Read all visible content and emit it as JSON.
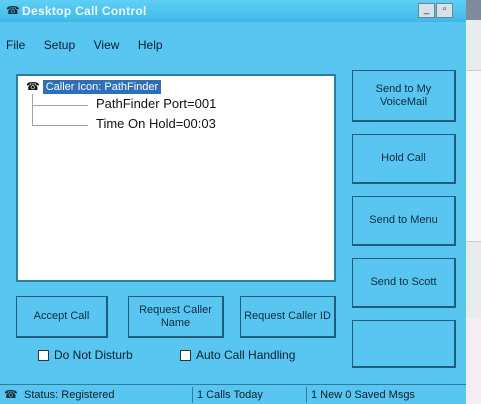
{
  "window": {
    "title": "Desktop Call Control",
    "title_icon": "phone-icon",
    "minimize_glyph": "_",
    "maximize_glyph": "▫"
  },
  "menu": [
    "File",
    "Setup",
    "View",
    "Help"
  ],
  "tree": {
    "root_label": "Caller Icon: PathFinder",
    "root_icon": "phone-icon",
    "children": [
      "PathFinder Port=001",
      "Time On Hold=00:03"
    ]
  },
  "side_buttons": [
    "Send to My VoiceMail",
    "Hold Call",
    "Send to Menu",
    "Send to Scott",
    ""
  ],
  "bottom_buttons": [
    "Accept Call",
    "Request Caller Name",
    "Request Caller ID"
  ],
  "checkboxes": [
    {
      "label": "Do Not Disturb",
      "checked": false
    },
    {
      "label": "Auto Call Handling",
      "checked": false
    }
  ],
  "status": {
    "icon": "phone-icon",
    "state": "Status: Registered",
    "calls": "1 Calls Today",
    "messages": "1 New 0 Saved Msgs"
  },
  "colors": {
    "window_bg": "#58c6f1",
    "titlebar": "#3fb8e8",
    "selection": "#2f6fb8"
  }
}
